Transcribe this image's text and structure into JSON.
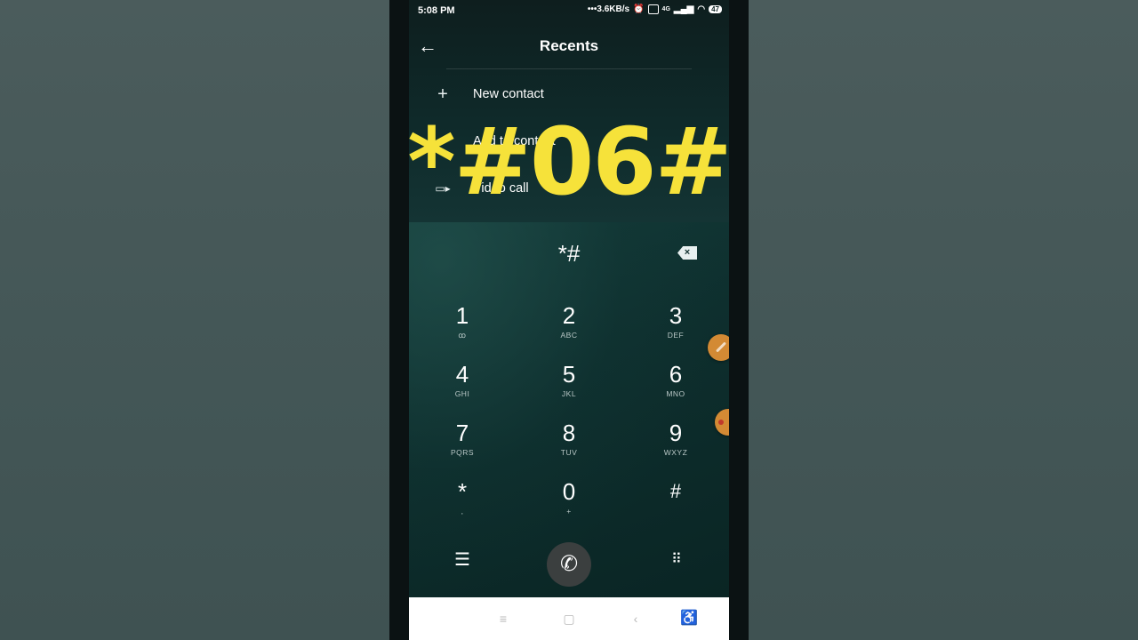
{
  "status_bar": {
    "time": "5:08 PM",
    "net_speed": "•••3.6KB/s",
    "network": "4G",
    "battery": "47"
  },
  "header": {
    "title": "Recents"
  },
  "menu": [
    {
      "icon": "plus-icon",
      "label": "New contact"
    },
    {
      "icon": "person-icon",
      "label": "Add to contact"
    },
    {
      "icon": "video-icon",
      "label": "Video call"
    }
  ],
  "overlay_text": "*#06#",
  "dialer": {
    "input": "*#",
    "keys": [
      {
        "digit": "1",
        "letters": "ꝏ"
      },
      {
        "digit": "2",
        "letters": "ABC"
      },
      {
        "digit": "3",
        "letters": "DEF"
      },
      {
        "digit": "4",
        "letters": "GHI"
      },
      {
        "digit": "5",
        "letters": "JKL"
      },
      {
        "digit": "6",
        "letters": "MNO"
      },
      {
        "digit": "7",
        "letters": "PQRS"
      },
      {
        "digit": "8",
        "letters": "TUV"
      },
      {
        "digit": "9",
        "letters": "WXYZ"
      },
      {
        "digit": "*",
        "letters": ","
      },
      {
        "digit": "0",
        "letters": "+"
      },
      {
        "digit": "#",
        "letters": ""
      }
    ]
  },
  "colors": {
    "overlay": "#f6e23a",
    "accent_float": "#d38a34"
  }
}
